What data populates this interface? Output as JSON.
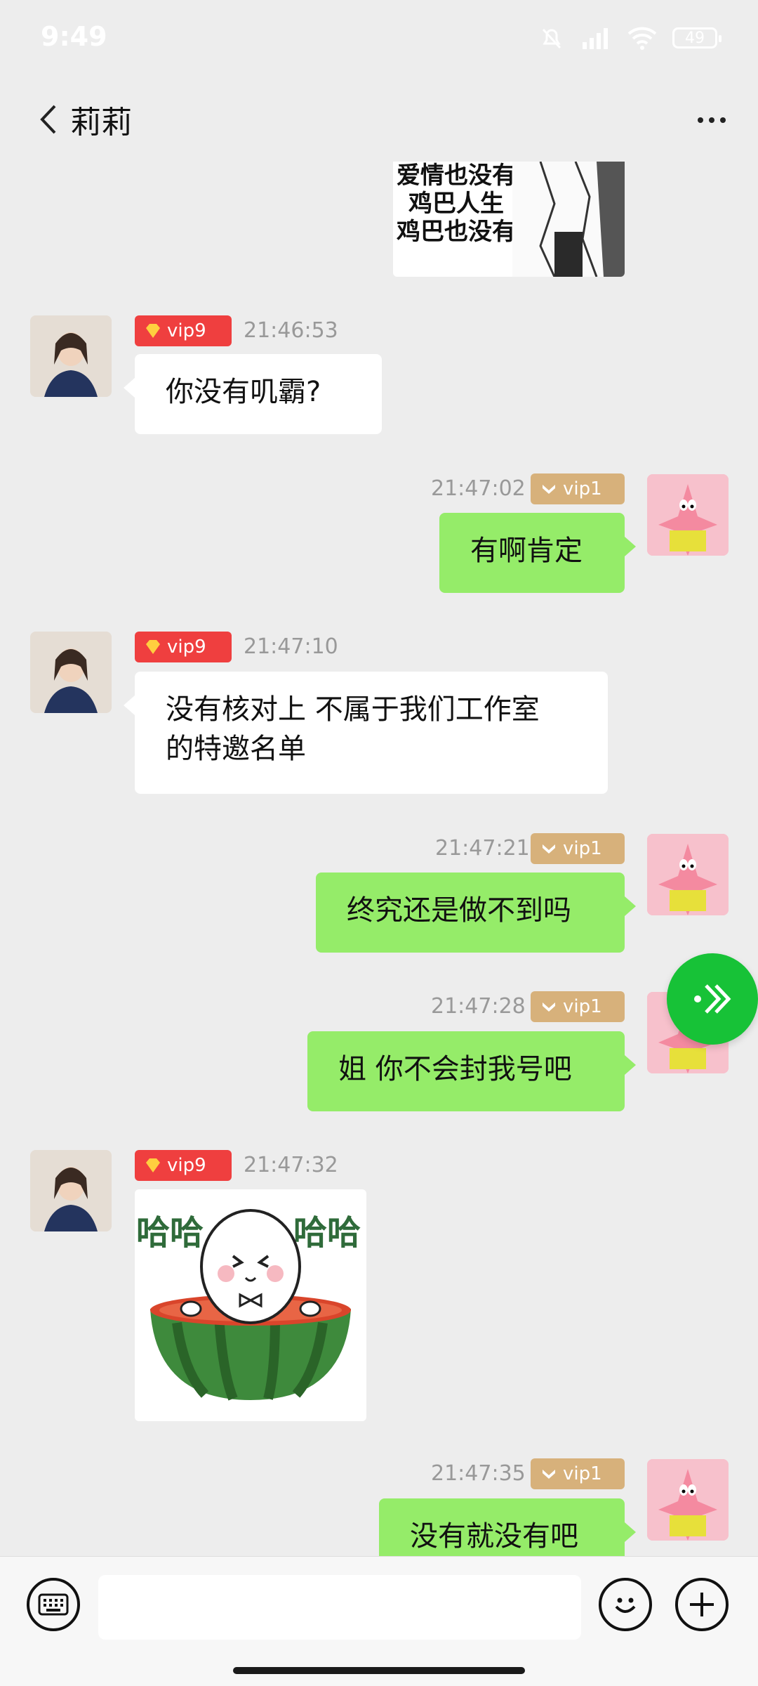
{
  "status_bar": {
    "time": "9:49",
    "battery": "49"
  },
  "header": {
    "title": "莉莉"
  },
  "chat": {
    "partial_image_text": [
      "爱情也没有",
      "鸡巴人生",
      "鸡巴也没有"
    ],
    "messages": [
      {
        "side": "in",
        "vip": "vip9",
        "time": "21:46:53",
        "text": "你没有叽霸?"
      },
      {
        "side": "out",
        "vip": "vip1",
        "time": "21:47:02",
        "text": "有啊肯定"
      },
      {
        "side": "in",
        "vip": "vip9",
        "time": "21:47:10",
        "line1": "没有核对上 不属于我们工作室",
        "line2": "的特邀名单"
      },
      {
        "side": "out",
        "vip": "vip1",
        "time": "21:47:21",
        "text": "终究还是做不到吗"
      },
      {
        "side": "out",
        "vip": "vip1",
        "time": "21:47:28",
        "text": "姐 你不会封我号吧"
      },
      {
        "side": "in",
        "vip": "vip9",
        "time": "21:47:32",
        "sticker_text_left": "哈哈",
        "sticker_text_right": "哈哈"
      },
      {
        "side": "out",
        "vip": "vip1",
        "time": "21:47:35",
        "text": "没有就没有吧"
      }
    ]
  },
  "icons": {
    "back": "chevron-left-icon",
    "more": "more-dots-icon",
    "keyboard": "keyboard-icon",
    "emoji": "emoji-icon",
    "plus": "plus-icon",
    "fab": "double-chevron-right-icon"
  },
  "colors": {
    "bubble_out": "#95ec69",
    "bubble_in": "#ffffff",
    "vip_red": "#ef3f3f",
    "vip_gold": "#d7b17b",
    "fab_green": "#17c237"
  }
}
